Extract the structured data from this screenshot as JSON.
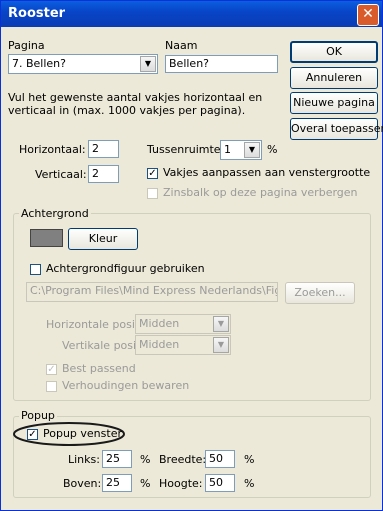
{
  "window": {
    "title": "Rooster",
    "close_symbol": "✕"
  },
  "pagina": {
    "label": "Pagina",
    "value": "7. Bellen?"
  },
  "naam": {
    "label": "Naam",
    "value": "Bellen?"
  },
  "buttons": {
    "ok": "OK",
    "annuleren": "Annuleren",
    "nieuwe_pagina": "Nieuwe pagina",
    "overal_toepassen": "Overal toepassen"
  },
  "instruction": {
    "line1": "Vul het gewenste aantal vakjes horizontaal en",
    "line2": "verticaal in (max. 1000 vakjes per pagina)."
  },
  "horizontaal": {
    "label": "Horizontaal:",
    "value": "2"
  },
  "verticaal": {
    "label": "Verticaal:",
    "value": "2"
  },
  "tussenruimte": {
    "label": "Tussenruimte:",
    "value": "1",
    "unit": "%"
  },
  "options": {
    "vakjes_aanpassen": {
      "label": "Vakjes aanpassen aan venstergrootte",
      "checked": true
    },
    "zinsbalk": {
      "label": "Zinsbalk op deze pagina verbergen",
      "checked": false
    }
  },
  "achtergrond": {
    "legend": "Achtergrond",
    "color_hex": "#808080",
    "kleur_button": "Kleur",
    "figuur_checkbox": "Achtergrondfiguur gebruiken",
    "path": "C:\\Program Files\\Mind Express Nederlands\\Figuren\\b",
    "zoeken_button": "Zoeken...",
    "horizontale_positie": {
      "label": "Horizontale positie:",
      "value": "Midden"
    },
    "verticale_positie": {
      "label": "Vertikale positie:",
      "value": "Midden"
    },
    "best_passend": "Best passend",
    "verhoudingen": "Verhoudingen bewaren"
  },
  "popup": {
    "legend": "Popup",
    "venster_label": "Popup venster",
    "venster_checked": true,
    "links": {
      "label": "Links:",
      "value": "25",
      "unit": "%"
    },
    "breedte": {
      "label": "Breedte:",
      "value": "50",
      "unit": "%"
    },
    "boven": {
      "label": "Boven:",
      "value": "25",
      "unit": "%"
    },
    "hoogte": {
      "label": "Hoogte:",
      "value": "50",
      "unit": "%"
    }
  }
}
